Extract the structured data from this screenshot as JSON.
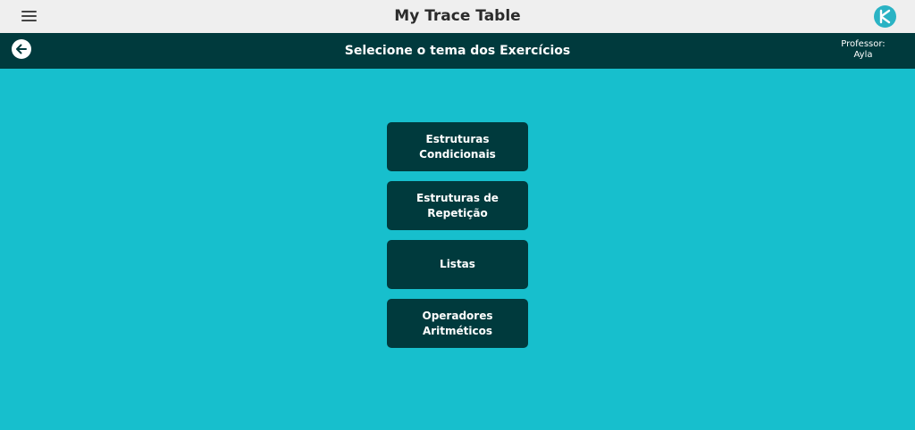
{
  "header": {
    "app_title": "My Trace Table",
    "menu_icon": "hamburger-menu-icon",
    "logo_icon": "app-logo-icon"
  },
  "subheader": {
    "title": "Selecione o tema dos Exercícios",
    "back_icon": "arrow-left-icon",
    "teacher_label": "Professor:",
    "teacher_name": "Ayla"
  },
  "topics": [
    {
      "label": "Estruturas Condicionais"
    },
    {
      "label": "Estruturas de Repetição"
    },
    {
      "label": "Listas"
    },
    {
      "label": "Operadores Aritméticos"
    }
  ],
  "colors": {
    "background": "#17bfcd",
    "topbar": "#efefef",
    "dark_teal": "#003a3d",
    "logo": "#2ab3c4"
  }
}
